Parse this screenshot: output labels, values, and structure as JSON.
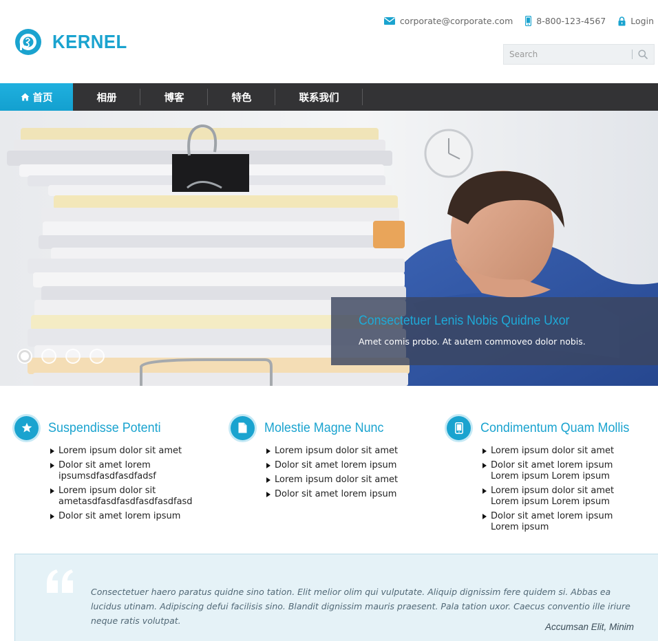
{
  "brand": {
    "name": "KERNEL",
    "accent": "#1aa3cf"
  },
  "topbar": {
    "email": "corporate@corporate.com",
    "phone": "8-800-123-4567",
    "login": "Login",
    "icons": [
      "envelope-icon",
      "mobile-phone-icon",
      "lock-icon"
    ]
  },
  "search": {
    "placeholder": "Search",
    "icon": "search-icon"
  },
  "nav": {
    "items": [
      {
        "label": "首页",
        "active": true,
        "icon": "home-icon"
      },
      {
        "label": "相册"
      },
      {
        "label": "博客"
      },
      {
        "label": "特色"
      },
      {
        "label": "联系我们"
      }
    ]
  },
  "hero": {
    "caption_title": "Consectetuer Lenis Nobis Quidne Uxor",
    "caption_text": "Amet comis probo. At autem commoveo dolor nobis.",
    "slide_count": 4,
    "active_slide": 1
  },
  "features": [
    {
      "title": "Suspendisse Potenti",
      "icon": "star-icon",
      "items": [
        "Lorem ipsum dolor sit amet",
        "Dolor sit amet lorem ipsumsdfasdfasdfadsf",
        "Lorem ipsum dolor sit ametasdfasdfasdfasdfasdfasd",
        "Dolor sit amet lorem ipsum"
      ]
    },
    {
      "title": "Molestie Magne Nunc",
      "icon": "document-icon",
      "items": [
        "Lorem ipsum dolor sit amet",
        "Dolor sit amet lorem ipsum",
        "Lorem ipsum dolor sit amet",
        "Dolor sit amet lorem ipsum"
      ]
    },
    {
      "title": "Condimentum Quam Mollis",
      "icon": "tablet-icon",
      "items": [
        "Lorem ipsum dolor sit amet",
        "Dolor sit amet lorem ipsum Lorem ipsum Lorem ipsum",
        "Lorem ipsum dolor sit amet Lorem ipsum Lorem ipsum",
        "Dolor sit amet lorem ipsum Lorem ipsum"
      ]
    }
  ],
  "testimonial": {
    "text": "Consectetuer haero paratus quidne sino tation. Elit melior olim qui vulputate. Aliquip dignissim fere quidem si. Abbas ea lucidus utinam. Adipiscing defui facilisis sino. Blandit dignissim mauris praesent. Pala tation uxor. Caecus conventio ille iriure neque ratis volutpat.",
    "author": "Accumsan Elit, Minim"
  }
}
